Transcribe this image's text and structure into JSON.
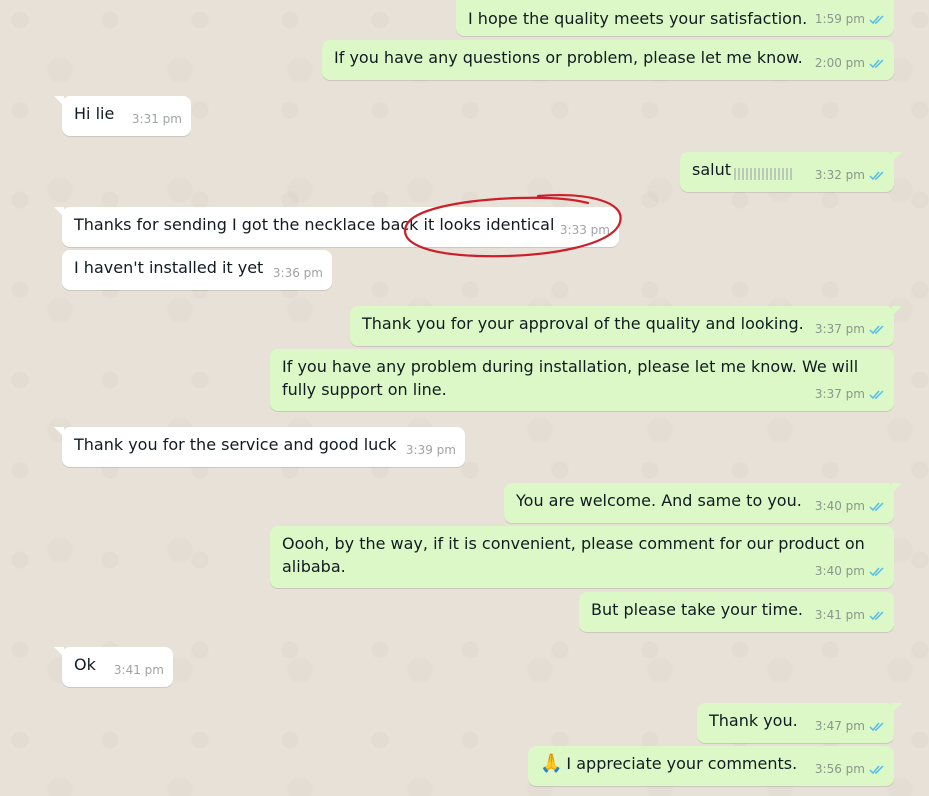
{
  "messages": [
    {
      "id": "m1",
      "text": "I hope the quality meets your satisfaction.",
      "time": "1:59 pm"
    },
    {
      "id": "m2",
      "text": "If you have any questions or problem,  please let me know.",
      "time": "2:00 pm"
    },
    {
      "id": "m3",
      "text": "Hi lie",
      "time": "3:31 pm"
    },
    {
      "id": "m4",
      "text": "salut",
      "time": "3:32 pm"
    },
    {
      "id": "m5",
      "text": "Thanks for sending I got the necklace back it looks identical",
      "time": "3:33 pm"
    },
    {
      "id": "m6",
      "text": "I haven't installed it yet",
      "time": "3:36 pm"
    },
    {
      "id": "m7",
      "text": "Thank you for your approval of the quality and looking.",
      "time": "3:37 pm"
    },
    {
      "id": "m8",
      "text": "If you have any problem during installation, please let me know. We will fully support on line.",
      "time": "3:37 pm"
    },
    {
      "id": "m9",
      "text": "Thank you for the service and good luck",
      "time": "3:39 pm"
    },
    {
      "id": "m10",
      "text": "You are welcome. And same to you.",
      "time": "3:40 pm"
    },
    {
      "id": "m11",
      "text": "Oooh, by the way, if it is convenient, please comment for our product on alibaba.",
      "time": "3:40 pm"
    },
    {
      "id": "m12",
      "text": "But please take your time.",
      "time": "3:41 pm"
    },
    {
      "id": "m13",
      "text": "Ok",
      "time": "3:41 pm"
    },
    {
      "id": "m14",
      "text": "Thank you.",
      "time": "3:47 pm"
    },
    {
      "id": "m15",
      "emoji": "🙏",
      "text": "I appreciate your comments.",
      "time": "3:56 pm"
    }
  ],
  "colors": {
    "outgoing_bubble": "#dcf8c6",
    "incoming_bubble": "#ffffff",
    "read_tick": "#53bdeb",
    "annotation_circle": "#cc1f2a",
    "background": "#e8e1d7"
  },
  "icons": {
    "read_receipt": "double-check-icon",
    "emoji": "folded-hands-emoji"
  }
}
